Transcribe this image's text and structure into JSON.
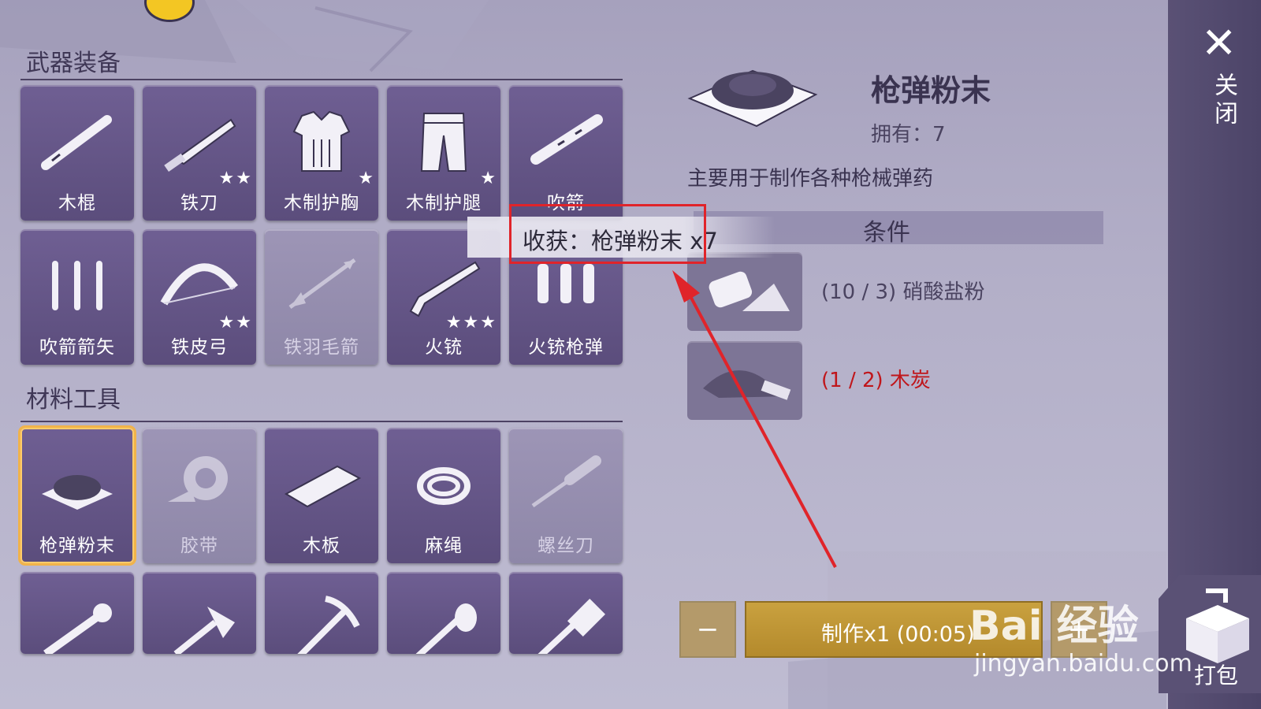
{
  "categories": {
    "weapons_title": "武器装备",
    "materials_title": "材料工具"
  },
  "weapons": [
    {
      "label": "木棍",
      "icon": "wooden-stick-icon",
      "stars": 0,
      "dim": false
    },
    {
      "label": "铁刀",
      "icon": "iron-knife-icon",
      "stars": 2,
      "dim": false
    },
    {
      "label": "木制护胸",
      "icon": "wooden-chest-armor-icon",
      "stars": 1,
      "dim": false
    },
    {
      "label": "木制护腿",
      "icon": "wooden-leg-armor-icon",
      "stars": 1,
      "dim": false
    },
    {
      "label": "吹箭",
      "icon": "blowgun-icon",
      "stars": 0,
      "dim": false
    },
    {
      "label": "吹箭箭矢",
      "icon": "blowgun-dart-icon",
      "stars": 0,
      "dim": false
    },
    {
      "label": "铁皮弓",
      "icon": "iron-bow-icon",
      "stars": 2,
      "dim": false
    },
    {
      "label": "铁羽毛箭",
      "icon": "iron-feather-arrow-icon",
      "stars": 0,
      "dim": true
    },
    {
      "label": "火铳",
      "icon": "musket-icon",
      "stars": 3,
      "dim": false
    },
    {
      "label": "火铳枪弹",
      "icon": "musket-bullet-icon",
      "stars": 0,
      "dim": false
    }
  ],
  "materials": [
    {
      "label": "枪弹粉末",
      "icon": "gunpowder-icon",
      "dim": false,
      "selected": true
    },
    {
      "label": "胶带",
      "icon": "tape-icon",
      "dim": true,
      "selected": false
    },
    {
      "label": "木板",
      "icon": "wooden-plank-icon",
      "dim": false,
      "selected": false
    },
    {
      "label": "麻绳",
      "icon": "rope-icon",
      "dim": false,
      "selected": false
    },
    {
      "label": "螺丝刀",
      "icon": "screwdriver-icon",
      "dim": true,
      "selected": false
    }
  ],
  "tools_partial": [
    "wrench-icon",
    "axe-icon",
    "pickaxe-icon",
    "stone-axe-icon",
    "hammer-icon"
  ],
  "detail": {
    "name": "枪弹粉末",
    "owned": "拥有：7",
    "description": "主要用于制作各种枪械弹药",
    "conditions_title": "条件",
    "requirements": [
      {
        "text": "(10 / 3) 硝酸盐粉",
        "color": "#4a4360",
        "icon": "nitrate-powder-icon"
      },
      {
        "text": "(1 / 2) 木炭",
        "color": "#c0161b",
        "icon": "charcoal-icon"
      }
    ]
  },
  "tooltip": "收获：枪弹粉末 x7",
  "craft": {
    "minus": "−",
    "button": "制作x1 (00:05)",
    "plus": "+"
  },
  "side": {
    "close_label": "关闭",
    "pack_label": "打包"
  },
  "watermark": {
    "logo": "Bai 经验",
    "url": "jingyan.baidu.com"
  },
  "colors": {
    "accent_gold": "#c9a13f",
    "warning_red": "#c0161b",
    "cell_purple": "#6f5f93",
    "selected_border": "#f1b34a"
  }
}
